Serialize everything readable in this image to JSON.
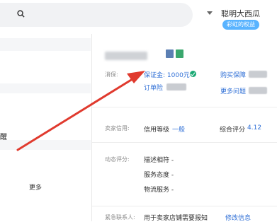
{
  "header": {
    "search_icon": "search-icon",
    "username": "聪明大西瓜",
    "benefit_badge": "彩虹的权益"
  },
  "left_list": {
    "item_a": "醒",
    "item_b": "更多"
  },
  "shop_panel": {
    "deposit_label": "消保:",
    "deposit_link": "保证金: 1000元",
    "deposit_link_2": "订单险",
    "protect_link": "购买保障",
    "more_questions_link": "更多问题",
    "credit_label": "卖家信用:",
    "credit_text": "信用等级",
    "credit_level": "一般",
    "overall_score_label": "综合评分",
    "overall_score_value": "4.12",
    "dynamic_label": "动态评分:",
    "desc_score": "描述相符 -",
    "service_score": "服务态度 -",
    "logistics_score": "物流服务 -",
    "contact_label": "紧急联系人:",
    "contact_text": "用于卖家店铺需要报知",
    "modify_link": "修改信息"
  },
  "colors": {
    "link": "#2f6fd6",
    "badge": "#58b3ff",
    "check": "#19a974",
    "arrow": "#e03a2e"
  }
}
